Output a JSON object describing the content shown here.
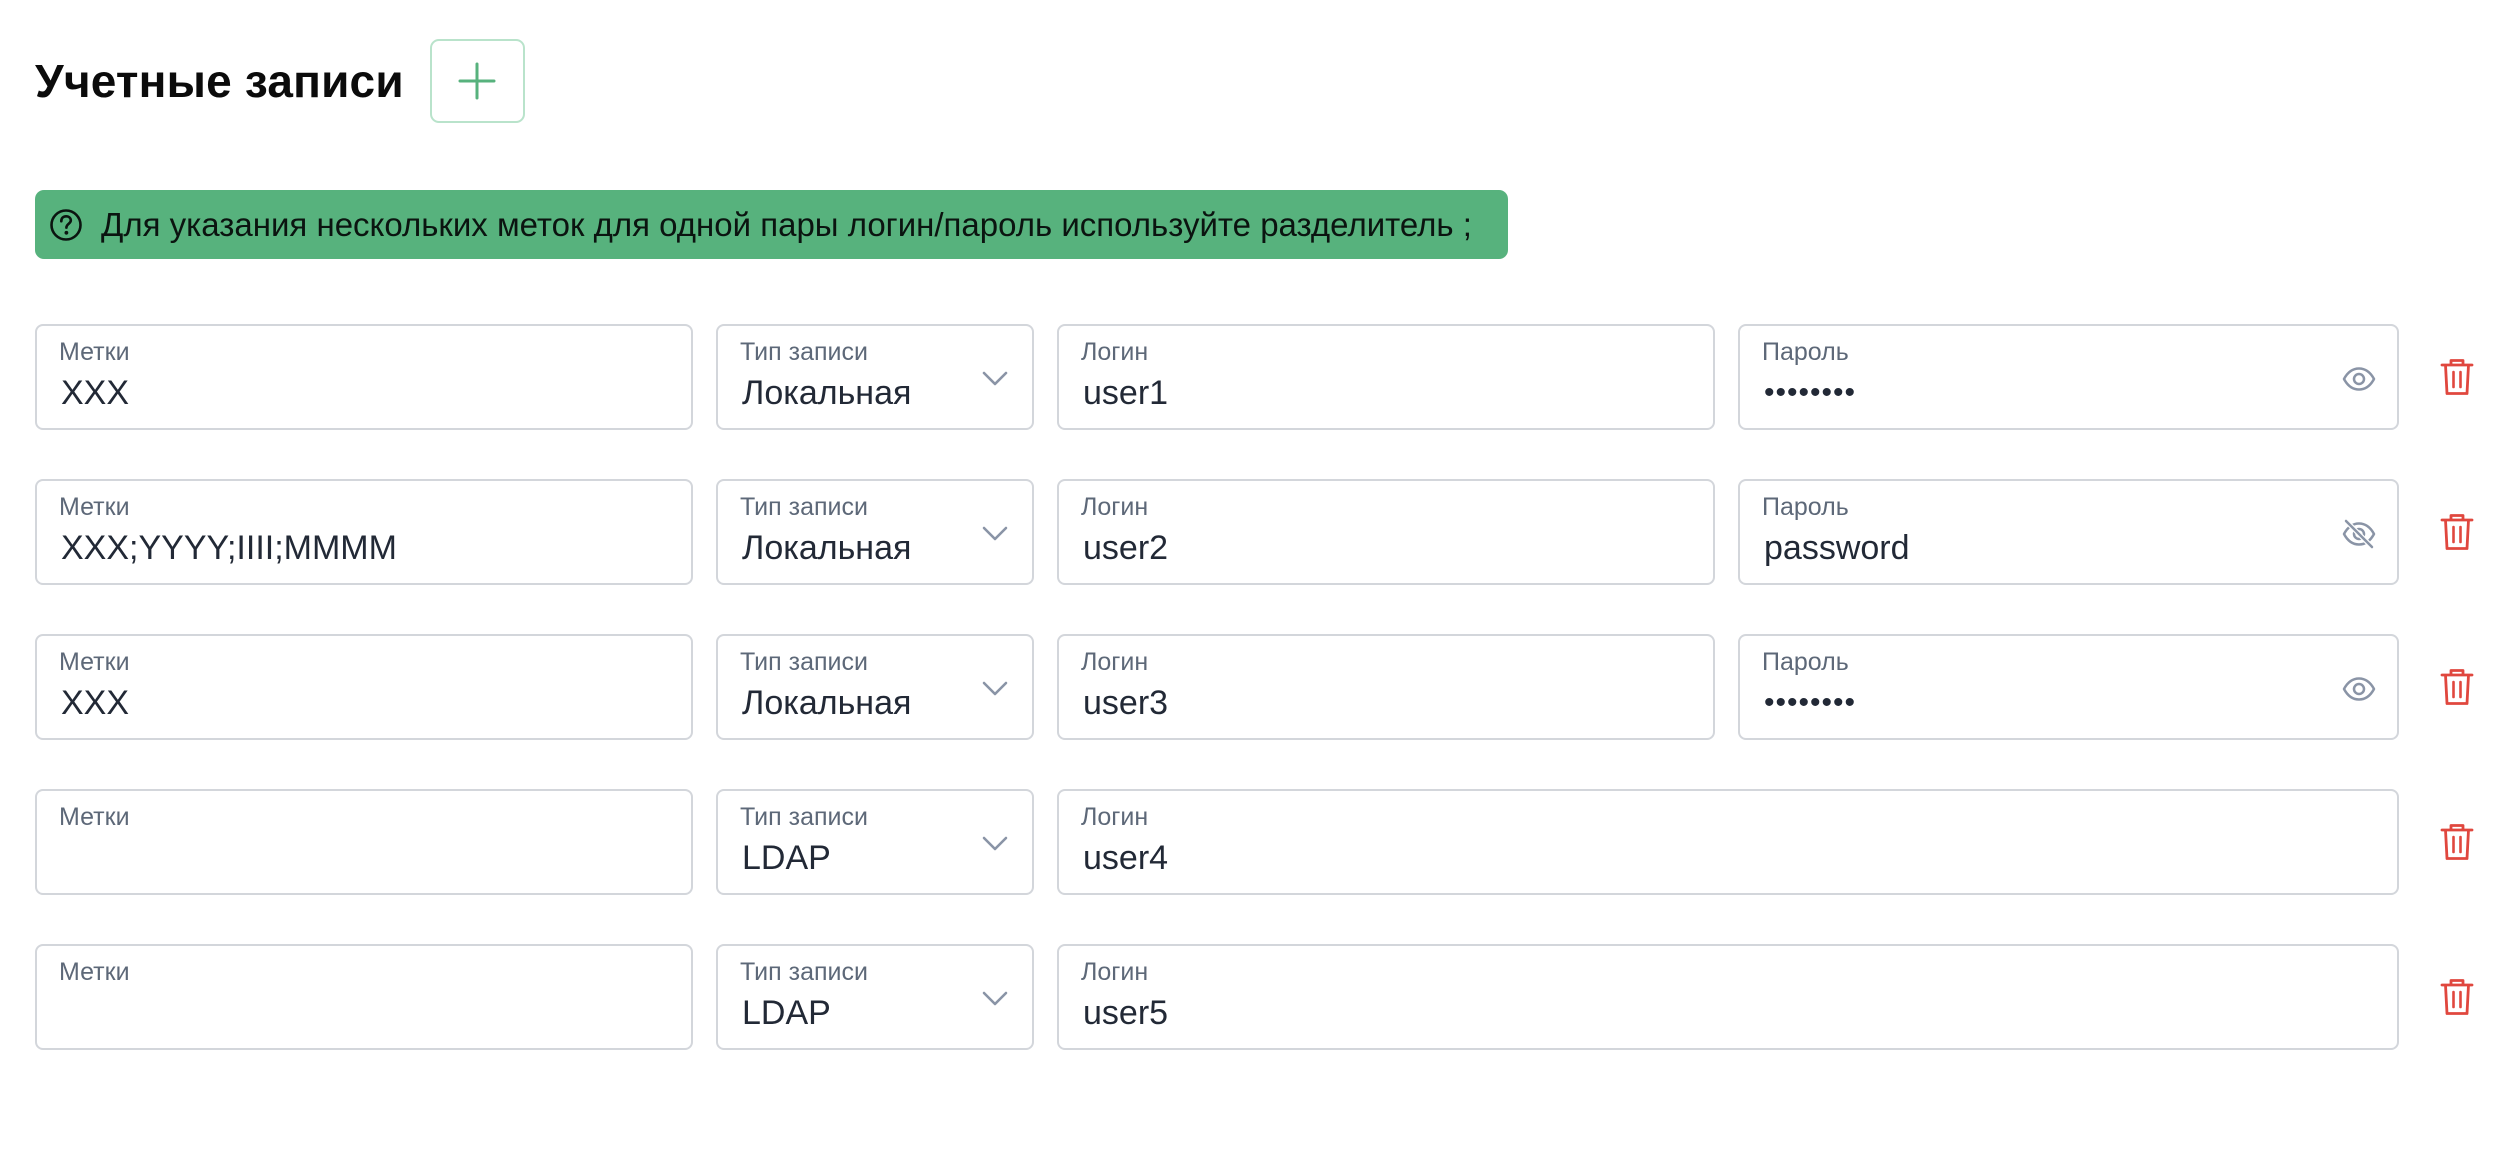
{
  "header": {
    "title": "Учетные записи",
    "add_icon": "plus-icon"
  },
  "hint": {
    "icon": "question-circle-icon",
    "text": "Для указания нескольких меток для одной пары логин/пароль используйте разделитель ;"
  },
  "labels": {
    "tags": "Метки",
    "type": "Тип записи",
    "login": "Логин",
    "password": "Пароль"
  },
  "accounts": [
    {
      "tags": "XXX",
      "type": "Локальная",
      "login": "user1",
      "password": "••••••••",
      "password_visible": false
    },
    {
      "tags": "XXX;YYYY;IIII;MMMM",
      "type": "Локальная",
      "login": "user2",
      "password": "password",
      "password_visible": true
    },
    {
      "tags": "XXX",
      "type": "Локальная",
      "login": "user3",
      "password": "••••••••",
      "password_visible": false
    },
    {
      "tags": "",
      "type": "LDAP",
      "login": "user4"
    },
    {
      "tags": "",
      "type": "LDAP",
      "login": "user5"
    }
  ],
  "colors": {
    "accent_green": "#57b27d",
    "add_button_border": "#b9e3cb",
    "delete_red": "#e0473e",
    "field_border": "#d3d6db",
    "icon_gray": "#8a94a6"
  },
  "icons": {
    "select": "chevron-down-icon",
    "show_password": "eye-icon",
    "hide_password": "eye-off-icon",
    "delete": "trash-icon"
  }
}
